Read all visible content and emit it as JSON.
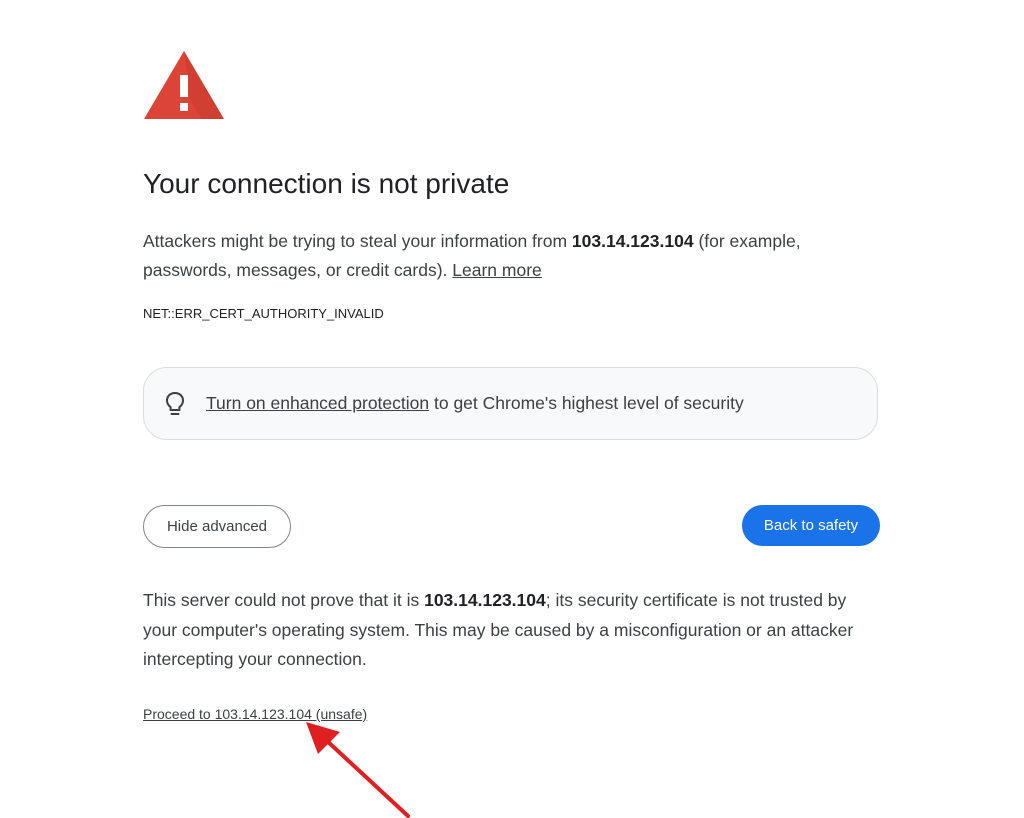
{
  "icons": {
    "warning": "warning-triangle-icon",
    "bulb": "lightbulb-icon",
    "arrow": "red-annotation-arrow"
  },
  "colors": {
    "warning_red": "#db4437",
    "primary_button_blue": "#1a73e8",
    "annotation_arrow_red": "#e02020",
    "box_background": "#f8f9fa"
  },
  "header": {
    "title": "Your connection is not private"
  },
  "main_message": {
    "prefix": "Attackers might be trying to steal your information from ",
    "host": "103.14.123.104",
    "suffix": " (for example, passwords, messages, or credit cards). ",
    "learn_more": "Learn more"
  },
  "error_code": "NET::ERR_CERT_AUTHORITY_INVALID",
  "enhanced_protection": {
    "link_text": "Turn on enhanced protection",
    "rest_text": " to get Chrome's highest level of security"
  },
  "buttons": {
    "hide_advanced": "Hide advanced",
    "back_to_safety": "Back to safety"
  },
  "details": {
    "prefix": "This server could not prove that it is ",
    "host": "103.14.123.104",
    "suffix": "; its security certificate is not trusted by your computer's operating system. This may be caused by a misconfiguration or an attacker intercepting your connection."
  },
  "proceed_link": "Proceed to 103.14.123.104 (unsafe)"
}
